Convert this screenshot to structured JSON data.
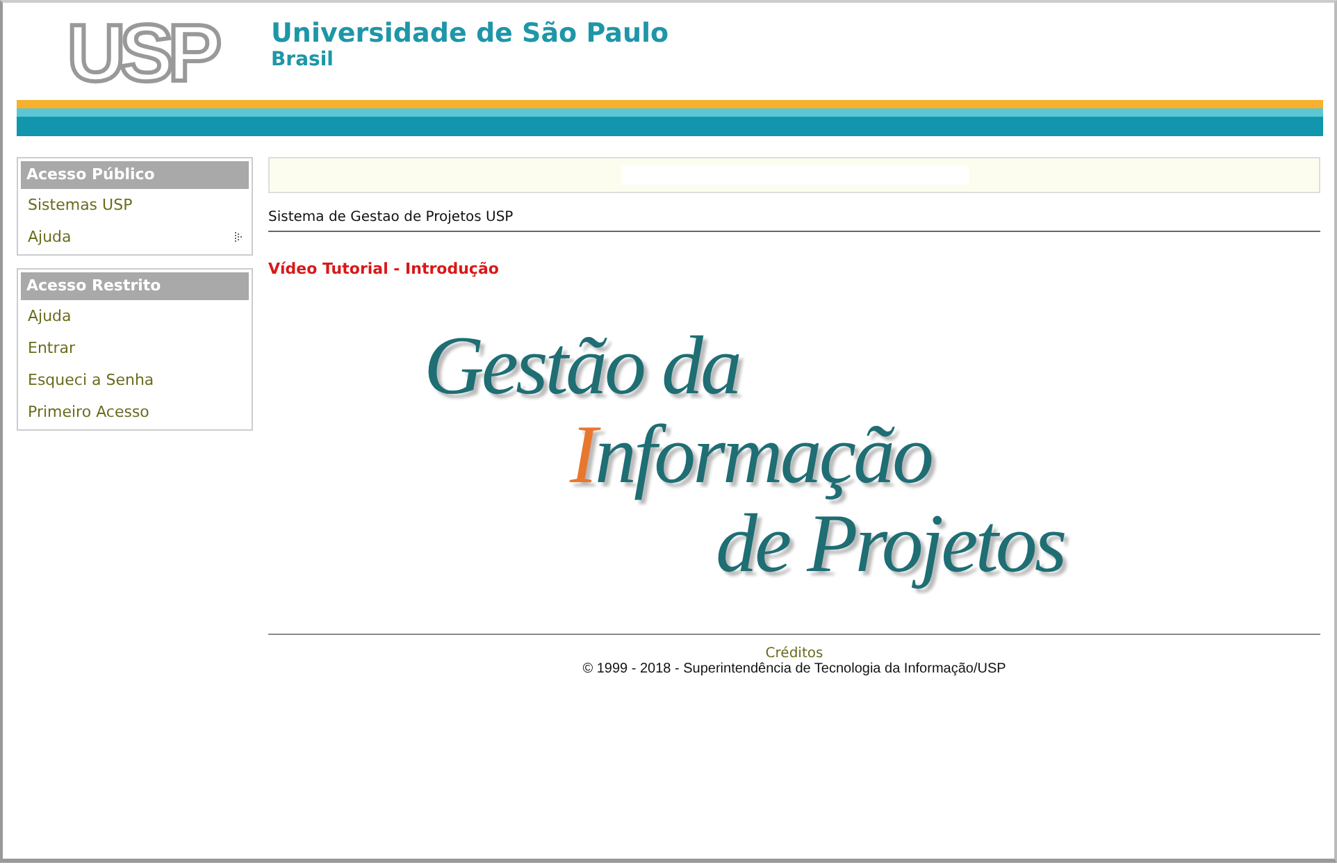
{
  "header": {
    "logo": "USP",
    "title": "Universidade de São Paulo",
    "subtitle": "Brasil"
  },
  "sidebar": [
    {
      "title": "Acesso Público",
      "items": [
        {
          "label": "Sistemas USP",
          "has_submenu": false
        },
        {
          "label": "Ajuda",
          "has_submenu": true
        }
      ]
    },
    {
      "title": "Acesso Restrito",
      "items": [
        {
          "label": "Ajuda",
          "has_submenu": false
        },
        {
          "label": "Entrar",
          "has_submenu": false
        },
        {
          "label": "Esqueci a Senha",
          "has_submenu": false
        },
        {
          "label": "Primeiro Acesso",
          "has_submenu": false
        }
      ]
    }
  ],
  "main": {
    "system_name": "Sistema de Gestao de Projetos USP",
    "video_link": "Vídeo Tutorial - Introdução",
    "banner_lines": [
      {
        "text": "Gestão da",
        "accent_initial": false
      },
      {
        "text": "Informação",
        "accent_initial": true
      },
      {
        "text": "de Projetos",
        "accent_initial": false
      }
    ]
  },
  "footer": {
    "credits_link": "Créditos",
    "copyright": "© 1999 - 2018 - Superintendência de Tecnologia da Informação/USP"
  }
}
